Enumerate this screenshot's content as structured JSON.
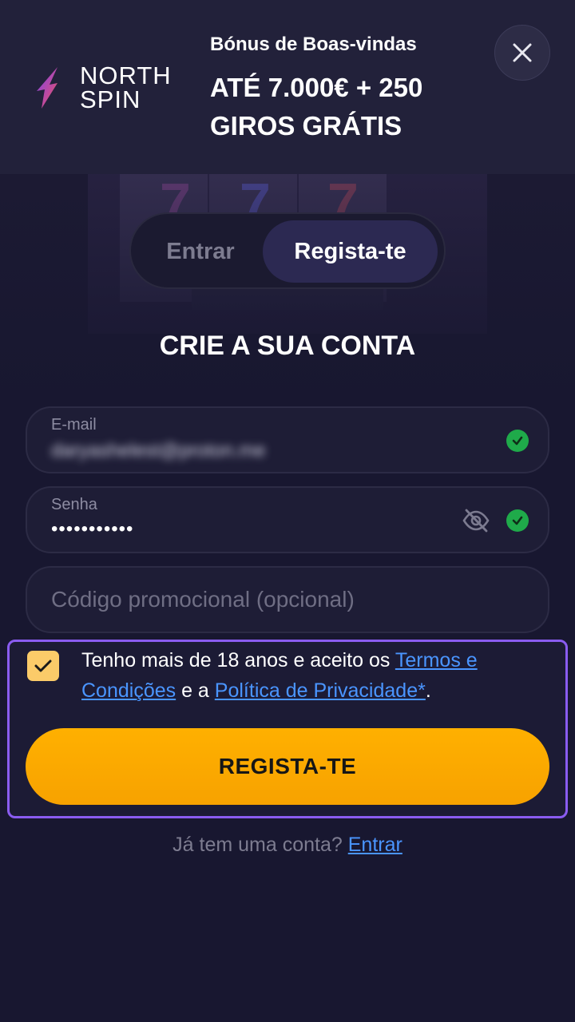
{
  "header": {
    "logo_line1": "NORTH",
    "logo_line2": "SPIN",
    "bonus_subtitle": "Bónus de Boas-vindas",
    "bonus_title": "ATÉ 7.000€ + 250 GIROS GRÁTIS",
    "close_icon": "close-icon"
  },
  "tabs": {
    "login": "Entrar",
    "register": "Regista-te",
    "active": "register"
  },
  "page_title": "CRIE A SUA CONTA",
  "form": {
    "email": {
      "label": "E-mail",
      "value": "daryashelest@proton.me",
      "valid": true
    },
    "password": {
      "label": "Senha",
      "value": "•••••••••••",
      "valid": true,
      "visibility_icon": "eye-off-icon"
    },
    "promo": {
      "placeholder": "Código promocional (opcional)"
    }
  },
  "consent": {
    "checked": true,
    "text_before": "Tenho mais de 18 anos e aceito os ",
    "terms_link": "Termos e Condições",
    "text_middle": " e a ",
    "privacy_link": "Política de Privacidade*",
    "text_after": "."
  },
  "register_button": "REGISTA-TE",
  "footer": {
    "question": "Já tem uma conta? ",
    "login_link": "Entrar"
  },
  "colors": {
    "background": "#181730",
    "accent_button": "#ffb000",
    "link": "#4a95ff",
    "highlight_border": "#8a5cf0",
    "valid": "#1faa4a"
  }
}
